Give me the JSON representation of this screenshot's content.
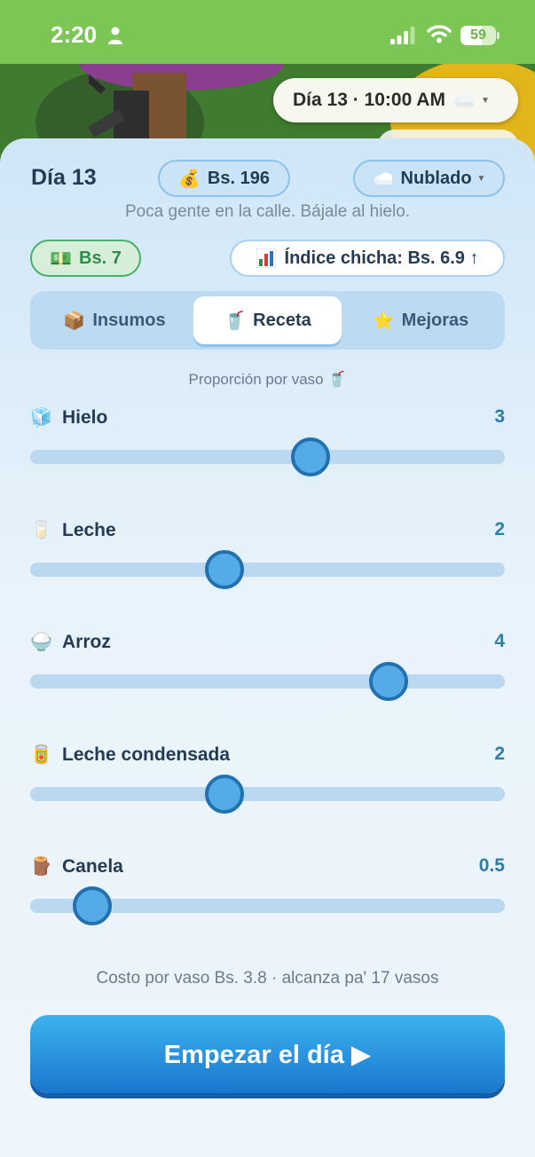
{
  "status_bar": {
    "time": "2:20",
    "battery": "59",
    "battery_level": 0.59
  },
  "header": {
    "day_time": "Día 13 · 10:00 AM",
    "weather_icon": "cloud-icon"
  },
  "panel": {
    "day_label": "Día 13",
    "money": {
      "icon": "money-bag-icon",
      "label": "Bs. 196"
    },
    "weather": {
      "icon": "cloud-icon",
      "label": "Nublado"
    },
    "weather_hint": "Poca gente en la calle. Bájale al hielo.",
    "cash": {
      "icon": "banknote-icon",
      "label": "Bs. 7"
    },
    "index": {
      "icon": "bar-chart-icon",
      "label": "Índice chicha: Bs. 6.9 ↑"
    }
  },
  "tabs": [
    {
      "icon": "📦",
      "label": "Insumos",
      "active": false
    },
    {
      "icon": "🥤",
      "label": "Receta",
      "active": true
    },
    {
      "icon": "⭐",
      "label": "Mejoras",
      "active": false
    }
  ],
  "proportion_label": "Proporción por vaso 🥤",
  "ingredients": [
    {
      "icon": "🧊",
      "name": "Hielo",
      "value": "3",
      "fraction": 0.59
    },
    {
      "icon": "🥛",
      "name": "Leche",
      "value": "2",
      "fraction": 0.41
    },
    {
      "icon": "🍚",
      "name": "Arroz",
      "value": "4",
      "fraction": 0.756
    },
    {
      "icon": "🥫",
      "name": "Leche condensada",
      "value": "2",
      "fraction": 0.41
    },
    {
      "icon": "🪵",
      "name": "Canela",
      "value": "0.5",
      "fraction": 0.13
    }
  ],
  "cost_line": "Costo por vaso Bs. 3.8 · alcanza pa' 17 vasos",
  "start_button": "Empezar el día ▶",
  "colors": {
    "status_green": "#7cc655",
    "accent_blue": "#2171b0",
    "cash_green": "#2e8c4b"
  }
}
